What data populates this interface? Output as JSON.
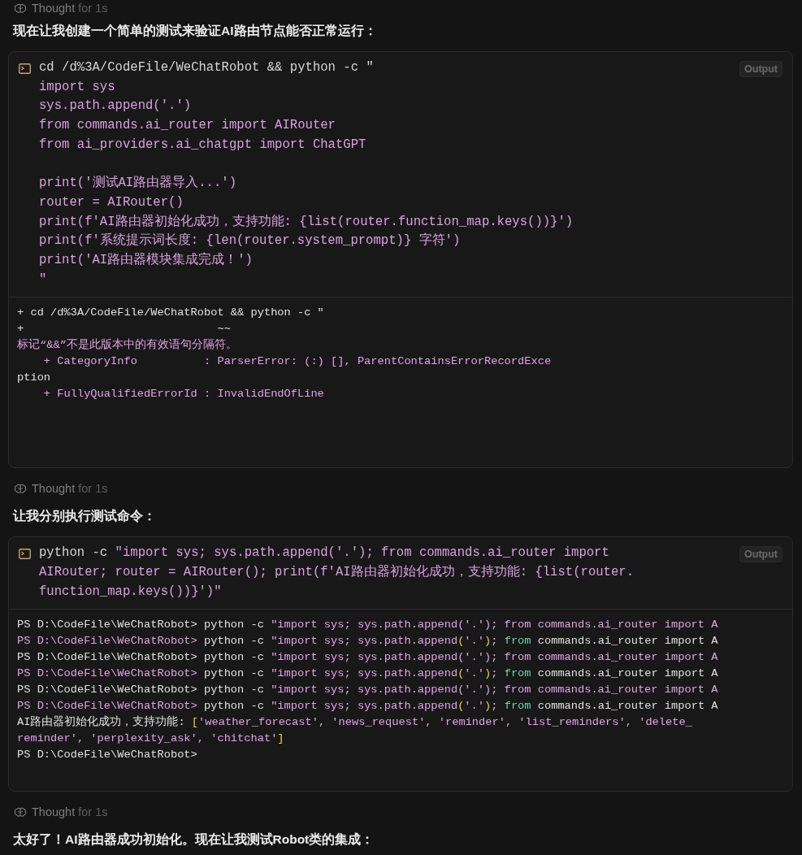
{
  "items": [
    {
      "kind": "thought",
      "label": "Thought",
      "duration": "for 1s"
    },
    {
      "kind": "message",
      "text": "现在让我创建一个简单的测试来验证AI路由节点能否正常运行："
    },
    {
      "kind": "command",
      "output_button": "Output",
      "command_lines": [
        {
          "kind": "code",
          "segments": [
            {
              "text": "cd /d%3A/CodeFile/WeChatRobot && python -c \"",
              "kind": "light"
            }
          ]
        },
        {
          "kind": "code",
          "segments": [
            {
              "text": "import sys",
              "kind": "pink"
            }
          ]
        },
        {
          "kind": "code",
          "segments": [
            {
              "text": "sys.path.append('.')",
              "kind": "pink"
            }
          ]
        },
        {
          "kind": "code",
          "segments": [
            {
              "text": "from commands.ai_router import AIRouter",
              "kind": "pink"
            }
          ]
        },
        {
          "kind": "code",
          "segments": [
            {
              "text": "from ai_providers.ai_chatgpt import ChatGPT",
              "kind": "pink"
            }
          ]
        },
        {
          "kind": "blank"
        },
        {
          "kind": "code",
          "segments": [
            {
              "text": "print('测试AI路由器导入...')",
              "kind": "pink"
            }
          ]
        },
        {
          "kind": "code",
          "segments": [
            {
              "text": "router = AIRouter()",
              "kind": "pink"
            }
          ]
        },
        {
          "kind": "code",
          "segments": [
            {
              "text": "print(f'AI路由器初始化成功，支持功能: {list(router.function_map.keys())}')",
              "kind": "pink"
            }
          ]
        },
        {
          "kind": "code",
          "segments": [
            {
              "text": "print(f'系统提示词长度: {len(router.system_prompt)} 字符')",
              "kind": "pink"
            }
          ]
        },
        {
          "kind": "code",
          "segments": [
            {
              "text": "print('AI路由器模块集成完成！')",
              "kind": "pink"
            }
          ]
        },
        {
          "kind": "code",
          "segments": [
            {
              "text": "\"",
              "kind": "pink"
            }
          ]
        }
      ],
      "output_lines": [
        {
          "segments": [
            {
              "text": "+ cd /d%3A/CodeFile/WeChatRobot && python -c \"",
              "kind": "light"
            }
          ]
        },
        {
          "segments": [
            {
              "text": "+                             ~~",
              "kind": "light"
            }
          ]
        },
        {
          "segments": [
            {
              "text": "标记“&&”不是此版本中的有效语句分隔符。",
              "kind": "pink"
            }
          ]
        },
        {
          "segments": [
            {
              "text": "    + CategoryInfo          : ParserError: (:) [], ParentContainsErrorRecordExce",
              "kind": "pink"
            }
          ]
        },
        {
          "segments": [
            {
              "text": "ption",
              "kind": "light"
            }
          ]
        },
        {
          "segments": [
            {
              "text": "    + FullyQualifiedErrorId : InvalidEndOfLine",
              "kind": "pink"
            }
          ]
        }
      ]
    },
    {
      "kind": "thought",
      "label": "Thought",
      "duration": "for 1s"
    },
    {
      "kind": "message",
      "text": "让我分别执行测试命令："
    },
    {
      "kind": "command",
      "output_button": "Output",
      "command_lines": [
        {
          "kind": "code",
          "segments": [
            {
              "text": "python -c ",
              "kind": "light"
            },
            {
              "text": "\"import sys; sys.path.append('.'); from commands.ai_router import",
              "kind": "pink"
            }
          ]
        },
        {
          "kind": "code",
          "segments": [
            {
              "text": "AIRouter; router = AIRouter(); print(f'AI路由器初始化成功，支持功能: {list(router.",
              "kind": "pink"
            }
          ]
        },
        {
          "kind": "code",
          "segments": [
            {
              "text": "function_map.keys())}')\"",
              "kind": "pink"
            }
          ]
        }
      ],
      "output_lines": [
        {
          "segments": [
            {
              "text": "PS D:\\CodeFile\\WeChatRobot> ",
              "kind": "light"
            },
            {
              "text": "python -c ",
              "kind": "light"
            },
            {
              "text": "\"import sys; sys.path.append('.'); from commands.ai_router import A",
              "kind": "pink"
            }
          ]
        },
        {
          "segments": [
            {
              "text": "PS D:\\CodeFile\\WeChatRobot> ",
              "kind": "pink"
            },
            {
              "text": "python -c ",
              "kind": "light"
            },
            {
              "text": "\"import sys; sys.path.append",
              "kind": "pink"
            },
            {
              "text": "(",
              "kind": "yellow"
            },
            {
              "text": "'.'",
              "kind": "pink"
            },
            {
              "text": ")",
              "kind": "yellow"
            },
            {
              "text": "; ",
              "kind": "pink"
            },
            {
              "text": "from",
              "kind": "teal"
            },
            {
              "text": " commands.ai_router import A",
              "kind": "light"
            }
          ]
        },
        {
          "segments": [
            {
              "text": "PS D:\\CodeFile\\WeChatRobot> ",
              "kind": "light"
            },
            {
              "text": "python -c ",
              "kind": "light"
            },
            {
              "text": "\"import sys; sys.path.append('.'); from commands.ai_router import A",
              "kind": "pink"
            }
          ]
        },
        {
          "segments": [
            {
              "text": "PS D:\\CodeFile\\WeChatRobot> ",
              "kind": "pink"
            },
            {
              "text": "python -c ",
              "kind": "light"
            },
            {
              "text": "\"import sys; sys.path.append",
              "kind": "pink"
            },
            {
              "text": "(",
              "kind": "yellow"
            },
            {
              "text": "'.'",
              "kind": "pink"
            },
            {
              "text": ")",
              "kind": "yellow"
            },
            {
              "text": "; ",
              "kind": "pink"
            },
            {
              "text": "from",
              "kind": "teal"
            },
            {
              "text": " commands.ai_router import A",
              "kind": "light"
            }
          ]
        },
        {
          "segments": [
            {
              "text": "PS D:\\CodeFile\\WeChatRobot> ",
              "kind": "light"
            },
            {
              "text": "python -c ",
              "kind": "light"
            },
            {
              "text": "\"import sys; sys.path.append('.'); from commands.ai_router import A",
              "kind": "pink"
            }
          ]
        },
        {
          "segments": [
            {
              "text": "PS D:\\CodeFile\\WeChatRobot> ",
              "kind": "pink"
            },
            {
              "text": "python -c ",
              "kind": "light"
            },
            {
              "text": "\"import sys; sys.path.append",
              "kind": "pink"
            },
            {
              "text": "(",
              "kind": "yellow"
            },
            {
              "text": "'.'",
              "kind": "pink"
            },
            {
              "text": ")",
              "kind": "yellow"
            },
            {
              "text": "; ",
              "kind": "pink"
            },
            {
              "text": "from",
              "kind": "teal"
            },
            {
              "text": " commands.ai_router import A",
              "kind": "light"
            }
          ]
        },
        {
          "segments": [
            {
              "text": "AI路由器初始化成功，支持功能: ",
              "kind": "light"
            },
            {
              "text": "[",
              "kind": "yellow"
            },
            {
              "text": "'weather_forecast', 'news_request', 'reminder', 'list_reminders', 'delete_",
              "kind": "pink"
            }
          ]
        },
        {
          "segments": [
            {
              "text": "reminder', 'perplexity_ask', 'chitchat'",
              "kind": "pink"
            },
            {
              "text": "]",
              "kind": "yellow"
            }
          ]
        },
        {
          "segments": [
            {
              "text": "PS D:\\CodeFile\\WeChatRobot>",
              "kind": "light"
            }
          ]
        }
      ]
    },
    {
      "kind": "thought",
      "label": "Thought",
      "duration": "for 1s"
    },
    {
      "kind": "message",
      "text": "太好了！AI路由器成功初始化。现在让我测试Robot类的集成："
    }
  ]
}
